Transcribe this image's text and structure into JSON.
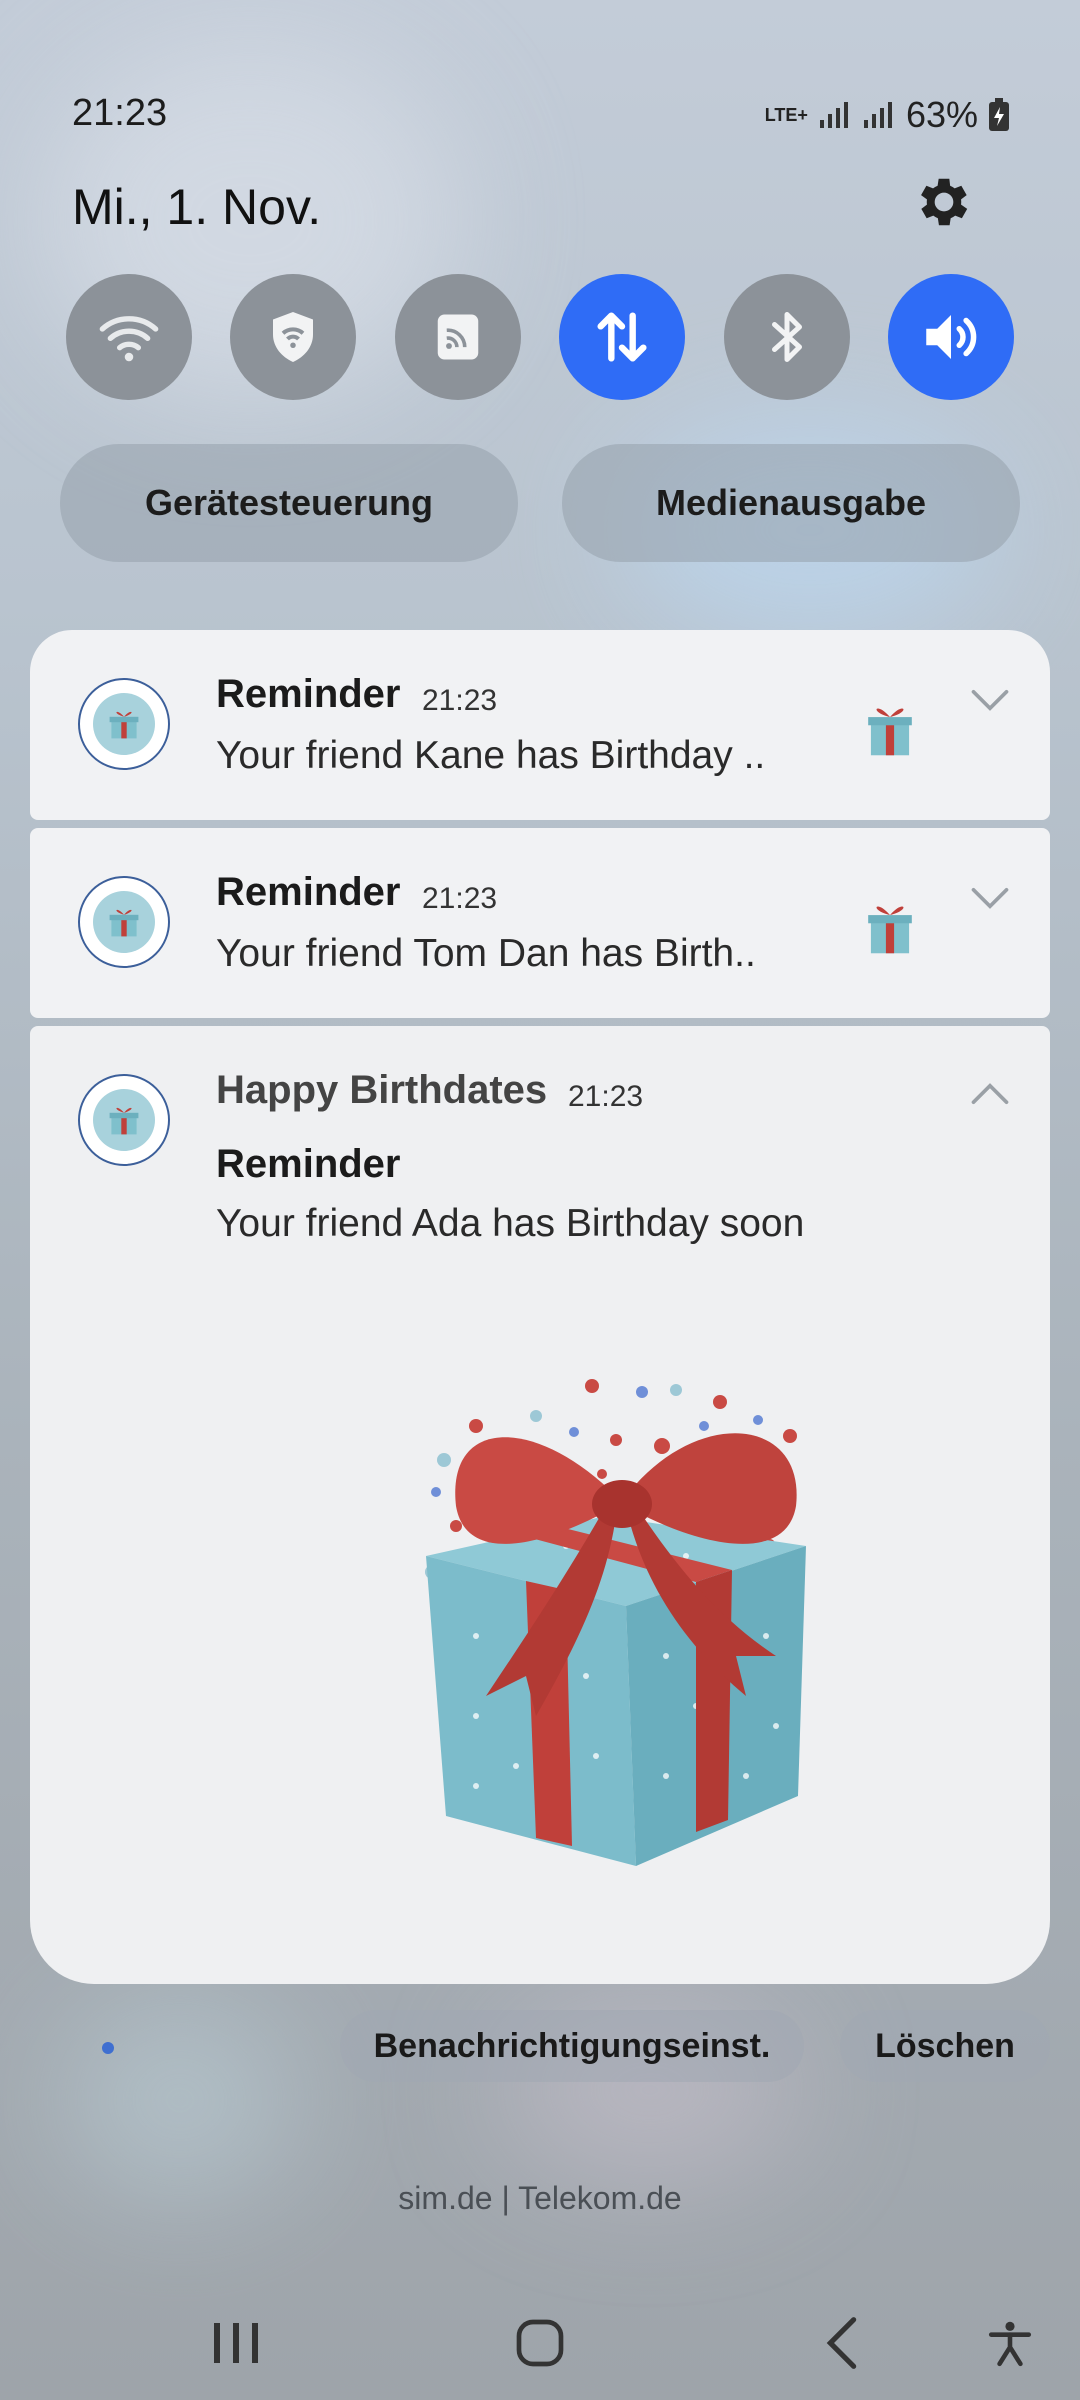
{
  "status_bar": {
    "time": "21:23",
    "network": "LTE+",
    "battery": "63%"
  },
  "header": {
    "date": "Mi., 1. Nov."
  },
  "quick_settings": [
    {
      "name": "wifi",
      "active": false
    },
    {
      "name": "secure-wifi",
      "active": false
    },
    {
      "name": "cast",
      "active": false
    },
    {
      "name": "mobile-data",
      "active": true
    },
    {
      "name": "bluetooth",
      "active": false
    },
    {
      "name": "sound",
      "active": true
    }
  ],
  "pills": {
    "device_control": "Gerätesteuerung",
    "media_output": "Medienausgabe"
  },
  "notifications": [
    {
      "title": "Reminder",
      "time": "21:23",
      "text": "Your friend Kane has Birthday .."
    },
    {
      "title": "Reminder",
      "time": "21:23",
      "text": "Your friend Tom Dan has Birth.."
    }
  ],
  "expanded": {
    "app_name": "Happy Birthdates",
    "time": "21:23",
    "title": "Reminder",
    "text": "Your friend Ada has Birthday soon"
  },
  "footer": {
    "settings_button": "Benachrichtigungseinst.",
    "clear_button": "Löschen",
    "carrier": "sim.de | Telekom.de"
  },
  "colors": {
    "accent": "#2f6cf6",
    "card": "#f1f2f4",
    "gift_red": "#c0403a",
    "gift_blue": "#7fc0cc"
  }
}
